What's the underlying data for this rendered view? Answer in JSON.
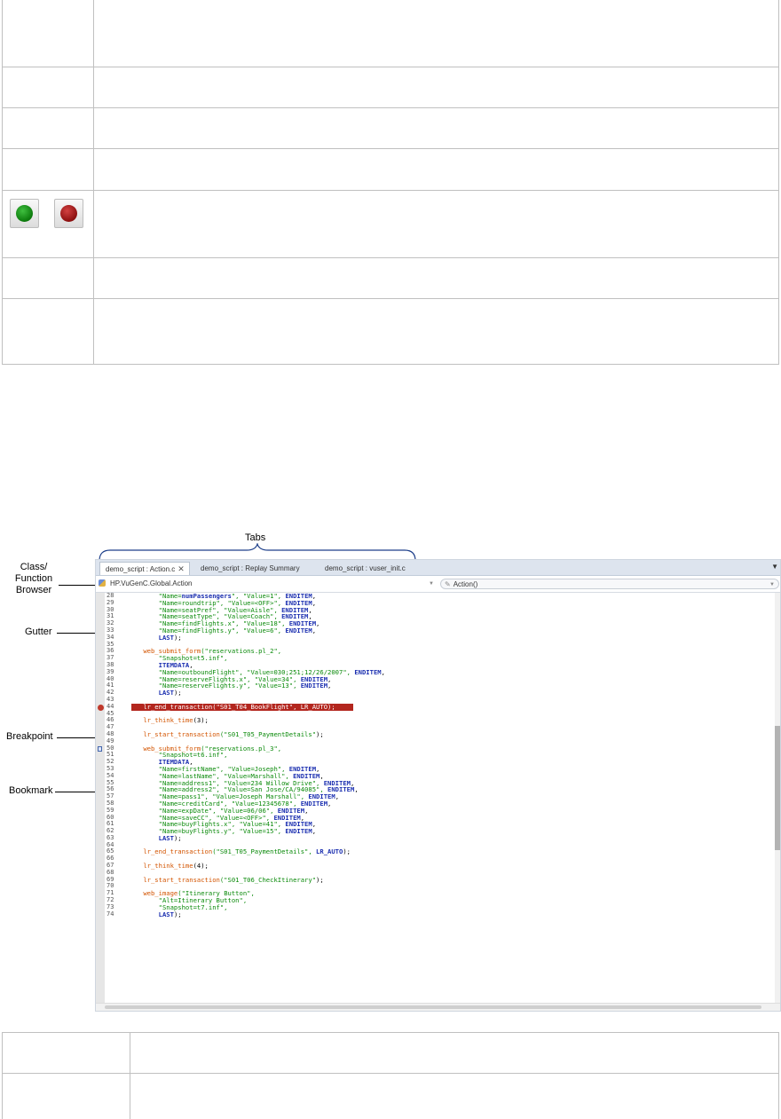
{
  "annotations": {
    "tabs": "Tabs",
    "class_function_browser": [
      "Class/",
      "Function",
      "Browser"
    ],
    "gutter": "Gutter",
    "breakpoint": "Breakpoint",
    "bookmark": "Bookmark"
  },
  "editor": {
    "tabs": [
      {
        "label": "demo_script : Action.c",
        "active": true,
        "closable": true
      },
      {
        "label": "demo_script : Replay Summary",
        "active": false
      },
      {
        "label": "demo_script : vuser_init.c",
        "active": false
      }
    ],
    "class_combo": "HP.VuGenC.Global.Action",
    "function_combo": "Action()",
    "lines": [
      {
        "num": "28",
        "t": [
          [
            "    \"Name=",
            "s"
          ],
          [
            "numPassengers",
            "b"
          ],
          [
            "\", \"Value=1\", ",
            "s"
          ],
          [
            "ENDITEM",
            "b"
          ],
          [
            ",",
            "n"
          ]
        ]
      },
      {
        "num": "29",
        "t": [
          [
            "    \"Name=roundtrip\", \"Value=<OFF>\", ",
            "s"
          ],
          [
            "ENDITEM",
            "b"
          ],
          [
            ",",
            "n"
          ]
        ]
      },
      {
        "num": "30",
        "t": [
          [
            "    \"Name=seatPref\", \"Value=Aisle\", ",
            "s"
          ],
          [
            "ENDITEM",
            "b"
          ],
          [
            ",",
            "n"
          ]
        ]
      },
      {
        "num": "31",
        "t": [
          [
            "    \"Name=seatType\", \"Value=Coach\", ",
            "s"
          ],
          [
            "ENDITEM",
            "b"
          ],
          [
            ",",
            "n"
          ]
        ]
      },
      {
        "num": "32",
        "t": [
          [
            "    \"Name=findFlights.x\", \"Value=18\", ",
            "s"
          ],
          [
            "ENDITEM",
            "b"
          ],
          [
            ",",
            "n"
          ]
        ]
      },
      {
        "num": "33",
        "t": [
          [
            "    \"Name=findFlights.y\", \"Value=6\", ",
            "s"
          ],
          [
            "ENDITEM",
            "b"
          ],
          [
            ",",
            "n"
          ]
        ]
      },
      {
        "num": "34",
        "t": [
          [
            "    ",
            "n"
          ],
          [
            "LAST",
            "b"
          ],
          [
            ");",
            "n"
          ]
        ]
      },
      {
        "num": "35",
        "t": []
      },
      {
        "num": "36",
        "t": [
          [
            "web_submit_form",
            "k"
          ],
          [
            "(\"reservations.pl_2\",",
            "s"
          ]
        ]
      },
      {
        "num": "37",
        "t": [
          [
            "    \"Snapshot=t5.inf\",",
            "s"
          ]
        ]
      },
      {
        "num": "38",
        "t": [
          [
            "    ",
            "n"
          ],
          [
            "ITEMDATA",
            "b"
          ],
          [
            ",",
            "n"
          ]
        ]
      },
      {
        "num": "39",
        "t": [
          [
            "    \"Name=outboundFlight\", \"Value=030;251;12/26/2007\", ",
            "s"
          ],
          [
            "ENDITEM",
            "b"
          ],
          [
            ",",
            "n"
          ]
        ]
      },
      {
        "num": "40",
        "t": [
          [
            "    \"Name=reserveFlights.x\", \"Value=34\", ",
            "s"
          ],
          [
            "ENDITEM",
            "b"
          ],
          [
            ",",
            "n"
          ]
        ]
      },
      {
        "num": "41",
        "t": [
          [
            "    \"Name=reserveFlights.y\", \"Value=13\", ",
            "s"
          ],
          [
            "ENDITEM",
            "b"
          ],
          [
            ",",
            "n"
          ]
        ]
      },
      {
        "num": "42",
        "t": [
          [
            "    ",
            "n"
          ],
          [
            "LAST",
            "b"
          ],
          [
            ");",
            "n"
          ]
        ]
      },
      {
        "num": "43",
        "t": []
      },
      {
        "num": "44",
        "t": [
          [
            "lr_end_transaction(\"S01_T04_BookFlight\", LR_AUTO);",
            "w"
          ]
        ],
        "hl": true
      },
      {
        "num": "45",
        "t": []
      },
      {
        "num": "46",
        "t": [
          [
            "lr_think_time",
            "k"
          ],
          [
            "(3);",
            "n"
          ]
        ]
      },
      {
        "num": "47",
        "t": []
      },
      {
        "num": "48",
        "t": [
          [
            "lr_start_transaction",
            "k"
          ],
          [
            "(\"S01_T05_PaymentDetails\"",
            "s"
          ],
          [
            ");",
            "n"
          ]
        ]
      },
      {
        "num": "49",
        "t": []
      },
      {
        "num": "50",
        "t": [
          [
            "web_submit_form",
            "k"
          ],
          [
            "(\"reservations.pl_3\",",
            "s"
          ]
        ]
      },
      {
        "num": "51",
        "t": [
          [
            "    \"Snapshot=t6.inf\",",
            "s"
          ]
        ]
      },
      {
        "num": "52",
        "t": [
          [
            "    ",
            "n"
          ],
          [
            "ITEMDATA",
            "b"
          ],
          [
            ",",
            "n"
          ]
        ]
      },
      {
        "num": "53",
        "t": [
          [
            "    \"Name=firstName\", \"Value=Joseph\", ",
            "s"
          ],
          [
            "ENDITEM",
            "b"
          ],
          [
            ",",
            "n"
          ]
        ]
      },
      {
        "num": "54",
        "t": [
          [
            "    \"Name=lastName\", \"Value=Marshall\", ",
            "s"
          ],
          [
            "ENDITEM",
            "b"
          ],
          [
            ",",
            "n"
          ]
        ]
      },
      {
        "num": "55",
        "t": [
          [
            "    \"Name=address1\", \"Value=234 Willow Drive\", ",
            "s"
          ],
          [
            "ENDITEM",
            "b"
          ],
          [
            ",",
            "n"
          ]
        ]
      },
      {
        "num": "56",
        "t": [
          [
            "    \"Name=address2\", \"Value=San Jose/CA/94085\", ",
            "s"
          ],
          [
            "ENDITEM",
            "b"
          ],
          [
            ",",
            "n"
          ]
        ]
      },
      {
        "num": "57",
        "t": [
          [
            "    \"Name=pass1\", \"Value=Joseph Marshall\", ",
            "s"
          ],
          [
            "ENDITEM",
            "b"
          ],
          [
            ",",
            "n"
          ]
        ]
      },
      {
        "num": "58",
        "t": [
          [
            "    \"Name=creditCard\", \"Value=12345678\", ",
            "s"
          ],
          [
            "ENDITEM",
            "b"
          ],
          [
            ",",
            "n"
          ]
        ]
      },
      {
        "num": "59",
        "t": [
          [
            "    \"Name=expDate\", \"Value=06/06\", ",
            "s"
          ],
          [
            "ENDITEM",
            "b"
          ],
          [
            ",",
            "n"
          ]
        ]
      },
      {
        "num": "60",
        "t": [
          [
            "    \"Name=saveCC\", \"Value=<OFF>\", ",
            "s"
          ],
          [
            "ENDITEM",
            "b"
          ],
          [
            ",",
            "n"
          ]
        ]
      },
      {
        "num": "61",
        "t": [
          [
            "    \"Name=buyFlights.x\", \"Value=41\", ",
            "s"
          ],
          [
            "ENDITEM",
            "b"
          ],
          [
            ",",
            "n"
          ]
        ]
      },
      {
        "num": "62",
        "t": [
          [
            "    \"Name=buyFlights.y\", \"Value=15\", ",
            "s"
          ],
          [
            "ENDITEM",
            "b"
          ],
          [
            ",",
            "n"
          ]
        ]
      },
      {
        "num": "63",
        "t": [
          [
            "    ",
            "n"
          ],
          [
            "LAST",
            "b"
          ],
          [
            ");",
            "n"
          ]
        ]
      },
      {
        "num": "64",
        "t": []
      },
      {
        "num": "65",
        "t": [
          [
            "lr_end_transaction",
            "k"
          ],
          [
            "(\"S01_T05_PaymentDetails\", ",
            "s"
          ],
          [
            "LR_AUTO",
            "b"
          ],
          [
            ");",
            "n"
          ]
        ]
      },
      {
        "num": "66",
        "t": []
      },
      {
        "num": "67",
        "t": [
          [
            "lr_think_time",
            "k"
          ],
          [
            "(4);",
            "n"
          ]
        ]
      },
      {
        "num": "68",
        "t": []
      },
      {
        "num": "69",
        "t": [
          [
            "lr_start_transaction",
            "k"
          ],
          [
            "(\"S01_T06_CheckItinerary\"",
            "s"
          ],
          [
            ");",
            "n"
          ]
        ]
      },
      {
        "num": "70",
        "t": []
      },
      {
        "num": "71",
        "t": [
          [
            "web_image",
            "k"
          ],
          [
            "(\"Itinerary Button\",",
            "s"
          ]
        ]
      },
      {
        "num": "72",
        "t": [
          [
            "    \"Alt=Itinerary Button\",",
            "s"
          ]
        ]
      },
      {
        "num": "73",
        "t": [
          [
            "    \"Snapshot=t7.inf\",",
            "s"
          ]
        ]
      },
      {
        "num": "74",
        "t": [
          [
            "    ",
            "n"
          ],
          [
            "LAST",
            "b"
          ],
          [
            ");",
            "n"
          ]
        ]
      }
    ]
  },
  "colors": {
    "keyword": "#d35400",
    "string": "#0a8a0a",
    "constant": "#1b2fb0",
    "breakpoint_highlight": "#b3261e"
  }
}
